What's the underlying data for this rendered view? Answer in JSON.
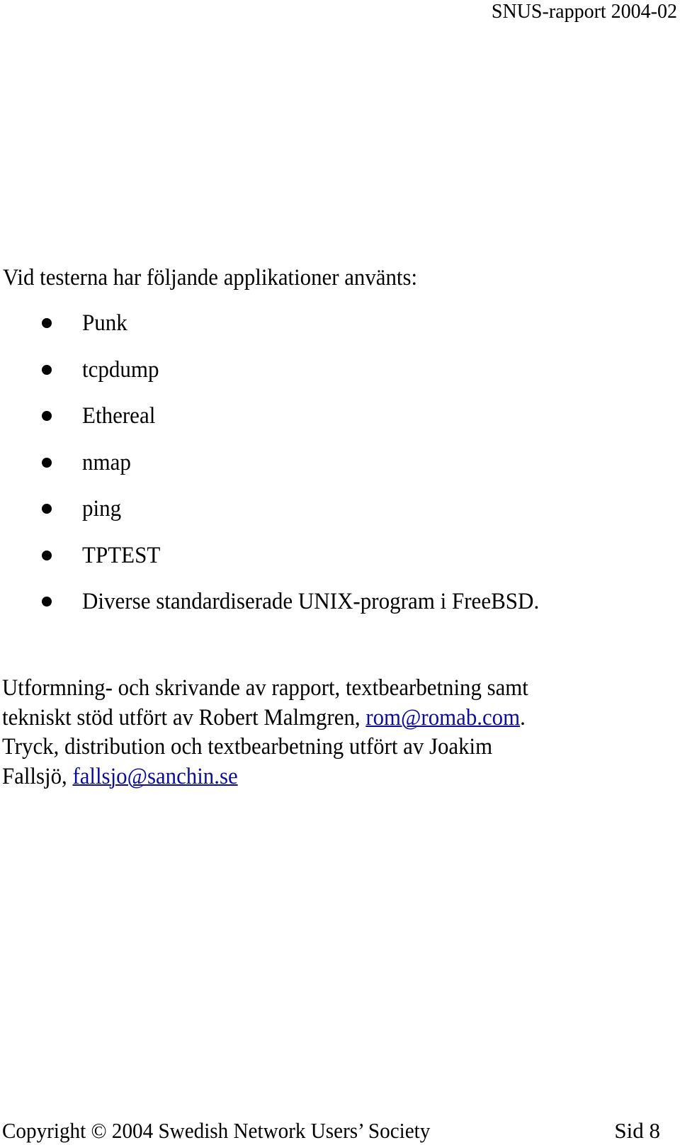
{
  "header": {
    "title": "SNUS-rapport 2004-02"
  },
  "intro": {
    "text": "Vid testerna har följande applikationer använts:"
  },
  "applications": [
    {
      "label": "Punk",
      "icon": "bullet-icon"
    },
    {
      "label": "tcpdump",
      "icon": "bullet-icon"
    },
    {
      "label": "Ethereal",
      "icon": "bullet-icon"
    },
    {
      "label": "nmap",
      "icon": "bullet-icon"
    },
    {
      "label": "ping",
      "icon": "bullet-icon"
    },
    {
      "label": "TPTEST",
      "icon": "bullet-icon"
    },
    {
      "label": "Diverse standardiserade UNIX-program i FreeBSD.",
      "icon": "bullet-icon"
    }
  ],
  "credits": {
    "line1": "Utformning- och skrivande av rapport, textbearbetning samt",
    "line2_prefix": "tekniskt stöd utfört av Robert Malmgren, ",
    "email1": "rom@romab.com",
    "line2_suffix": ".",
    "line3": "Tryck, distribution och textbearbetning utfört av Joakim",
    "line4_prefix": "Fallsjö, ",
    "email2": "fallsjo@sanchin.se",
    "link_color": "#0c0c9c"
  },
  "footer": {
    "copyright": "Copyright © 2004 Swedish Network Users’ Society",
    "page": "Sid 8"
  }
}
